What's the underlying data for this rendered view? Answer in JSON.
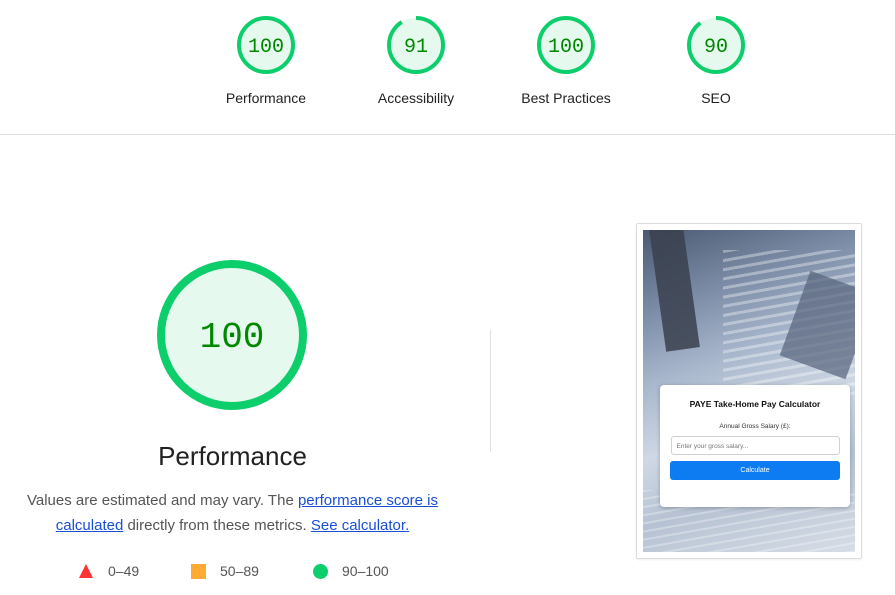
{
  "categories": [
    {
      "score": "100",
      "label": "Performance",
      "fraction": 1.0
    },
    {
      "score": "91",
      "label": "Accessibility",
      "fraction": 0.91
    },
    {
      "score": "100",
      "label": "Best Practices",
      "fraction": 1.0
    },
    {
      "score": "90",
      "label": "SEO",
      "fraction": 0.9
    }
  ],
  "main": {
    "score": "100",
    "fraction": 1.0,
    "title": "Performance",
    "desc_1": "Values are estimated and may vary. The ",
    "desc_link1": "performance score is calculated",
    "desc_2": " directly from these metrics. ",
    "desc_link2": "See calculator."
  },
  "legend": [
    {
      "range": "0–49",
      "shape": "triangle-icon",
      "color": "#ff3333"
    },
    {
      "range": "50–89",
      "shape": "square-icon",
      "color": "#ffaa33"
    },
    {
      "range": "90–100",
      "shape": "circle-icon",
      "color": "#0cce6b"
    }
  ],
  "screenshot": {
    "card_title": "PAYE Take-Home Pay Calculator",
    "salary_label": "Annual Gross Salary (£):",
    "salary_placeholder": "Enter your gross salary...",
    "button_label": "Calculate"
  },
  "colors": {
    "pass": "#0cce6b",
    "pass_fill": "#e5f9ee",
    "pass_text": "#008800"
  }
}
